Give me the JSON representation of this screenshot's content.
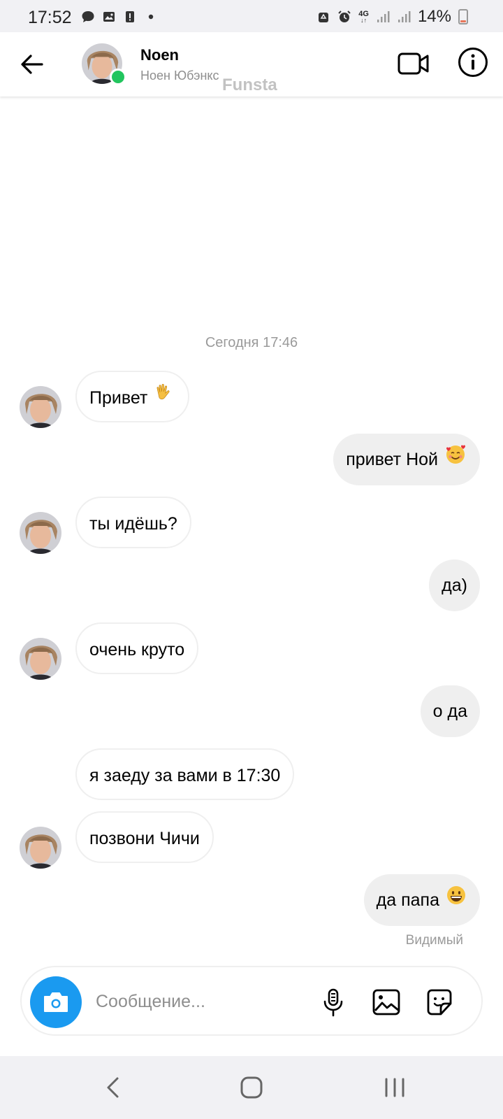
{
  "status_bar": {
    "time": "17:52",
    "network": "4G",
    "battery": "14%",
    "battery_level": 0.14,
    "icons": [
      "chat-bubble-icon",
      "image-icon",
      "alert-icon",
      "dot-icon",
      "recycle-icon",
      "alarm-icon",
      "signal-icon",
      "signal-icon",
      "battery-icon"
    ]
  },
  "header": {
    "name": "Noen",
    "subtitle": "Ноен Юбэнкс",
    "watermark": "Funsta",
    "online": true
  },
  "chat": {
    "timestamp": "Сегодня 17:46",
    "messages": [
      {
        "dir": "in",
        "text": "Привет",
        "emoji": "waving-hand-icon",
        "avatar": true
      },
      {
        "dir": "out",
        "text": "привет Ной",
        "emoji": "smiling-face-with-hearts-icon"
      },
      {
        "dir": "in",
        "text": "ты идёшь?",
        "avatar": true
      },
      {
        "dir": "out",
        "text": "да)"
      },
      {
        "dir": "in",
        "text": "очень круто",
        "avatar": true
      },
      {
        "dir": "out",
        "text": "о да"
      },
      {
        "dir": "in",
        "text": "я заеду за вами в 17:30",
        "avatar": false
      },
      {
        "dir": "in",
        "text": "позвони Чичи",
        "avatar": true
      },
      {
        "dir": "out",
        "text": "да папа",
        "emoji": "grinning-face-icon"
      }
    ],
    "seen": "Видимый"
  },
  "composer": {
    "placeholder": "Сообщение...",
    "value": ""
  },
  "colors": {
    "accent": "#1a9af0",
    "online": "#22c55e",
    "bubble_out": "#efefef",
    "bubble_in_border": "#efefef"
  }
}
